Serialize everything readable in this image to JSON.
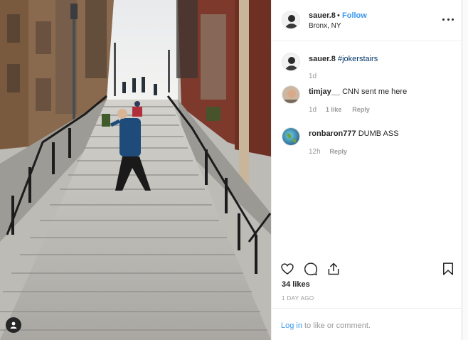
{
  "post": {
    "username": "sauer.8",
    "dot": "•",
    "follow_label": "Follow",
    "location": "Bronx, NY"
  },
  "comments": [
    {
      "username": "sauer.8",
      "text": "#jokerstairs",
      "time": "1d"
    },
    {
      "username": "timjay__",
      "text": "CNN sent me here",
      "time": "1d",
      "likes": "1 like",
      "reply": "Reply"
    },
    {
      "username": "ronbaron777",
      "text": "DUMB ASS",
      "time": "12h",
      "reply": "Reply"
    }
  ],
  "stats": {
    "likes": "34 likes",
    "posted": "1 DAY AGO"
  },
  "footer": {
    "login_link": "Log in",
    "login_rest": " to like or comment."
  },
  "icons": {
    "like": "heart-icon",
    "comment": "comment-icon",
    "share": "share-icon",
    "save": "bookmark-icon",
    "more": "more-options-icon",
    "user": "user-icon"
  }
}
